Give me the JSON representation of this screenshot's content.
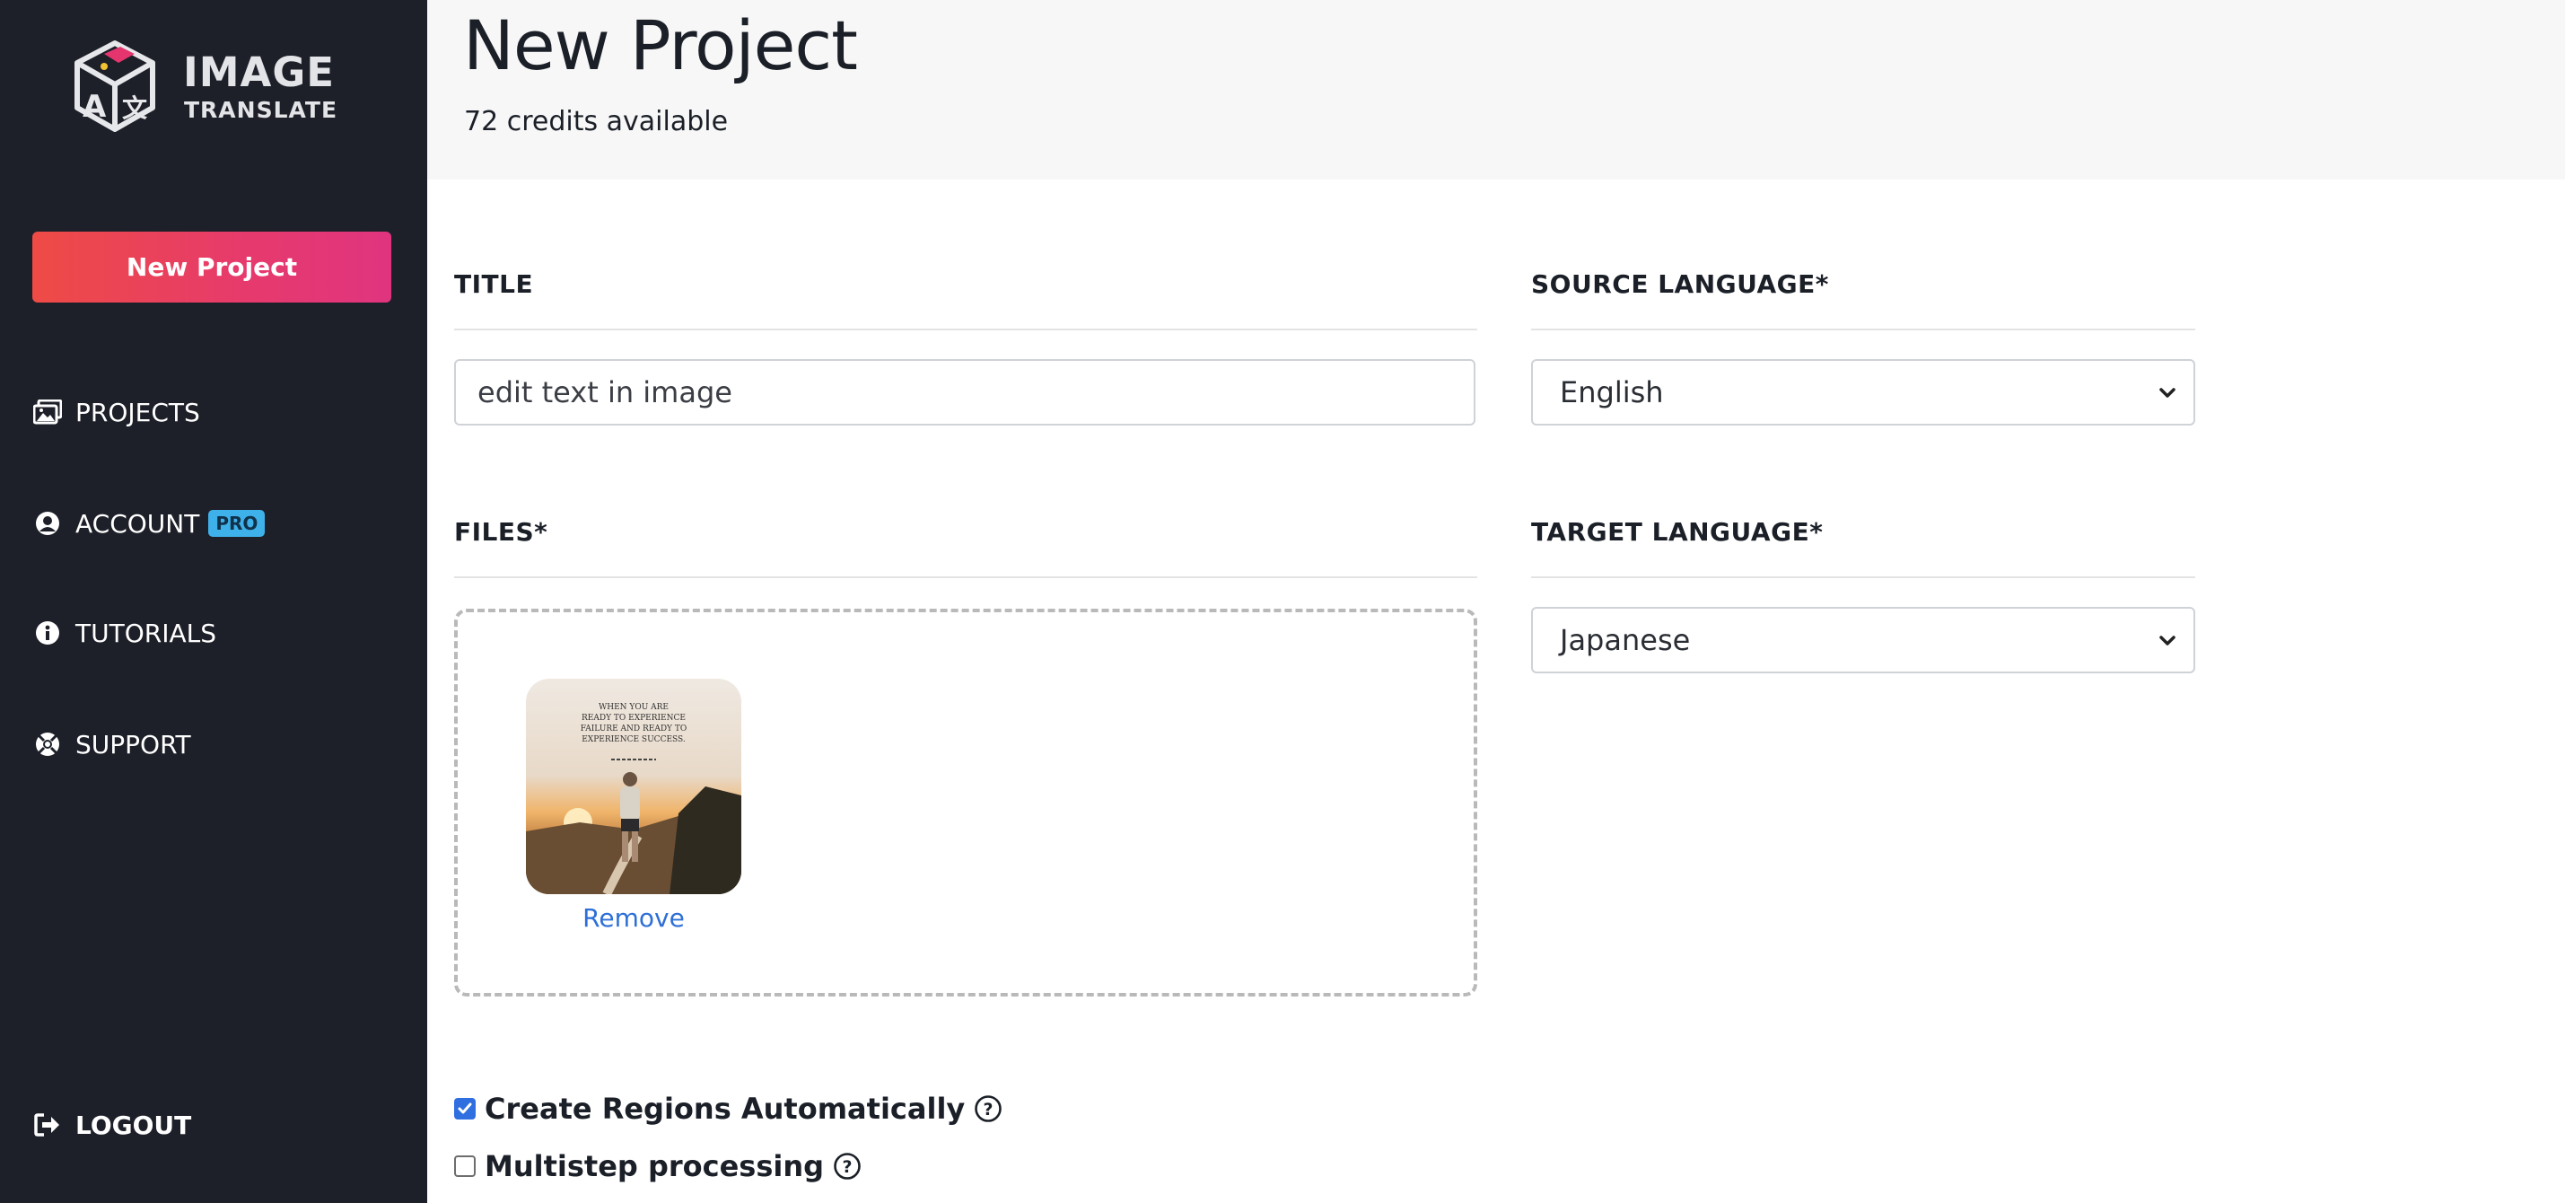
{
  "app": {
    "logo_line1": "IMAGE",
    "logo_line2": "TRANSLATE"
  },
  "sidebar": {
    "new_project_label": "New Project",
    "items": [
      {
        "label": "PROJECTS",
        "icon": "images-icon"
      },
      {
        "label": "ACCOUNT",
        "icon": "user-circle-icon",
        "badge": "PRO"
      },
      {
        "label": "TUTORIALS",
        "icon": "info-circle-icon"
      },
      {
        "label": "SUPPORT",
        "icon": "life-ring-icon"
      }
    ],
    "logout_label": "LOGOUT"
  },
  "header": {
    "title": "New Project",
    "credits": "72 credits available"
  },
  "form": {
    "title_label": "TITLE",
    "title_value": "edit text in image",
    "files_label": "FILES*",
    "remove_label": "Remove",
    "thumbnail_text": [
      "WHEN YOU ARE",
      "READY TO EXPERIENCE",
      "FAILURE AND READY TO",
      "EXPERIENCE SUCCESS."
    ],
    "source_language_label": "SOURCE LANGUAGE*",
    "source_language_value": "English",
    "target_language_label": "TARGET LANGUAGE*",
    "target_language_value": "Japanese",
    "create_regions_label": "Create Regions Automatically",
    "create_regions_checked": true,
    "multistep_label": "Multistep processing",
    "multistep_checked": false
  },
  "colors": {
    "sidebar_bg": "#1d2029",
    "button_gradient_start": "#ee4b45",
    "button_gradient_end": "#e0347f",
    "pro_badge": "#3fb1ea",
    "link": "#2d6fd6",
    "checkbox": "#2f6fe0"
  }
}
